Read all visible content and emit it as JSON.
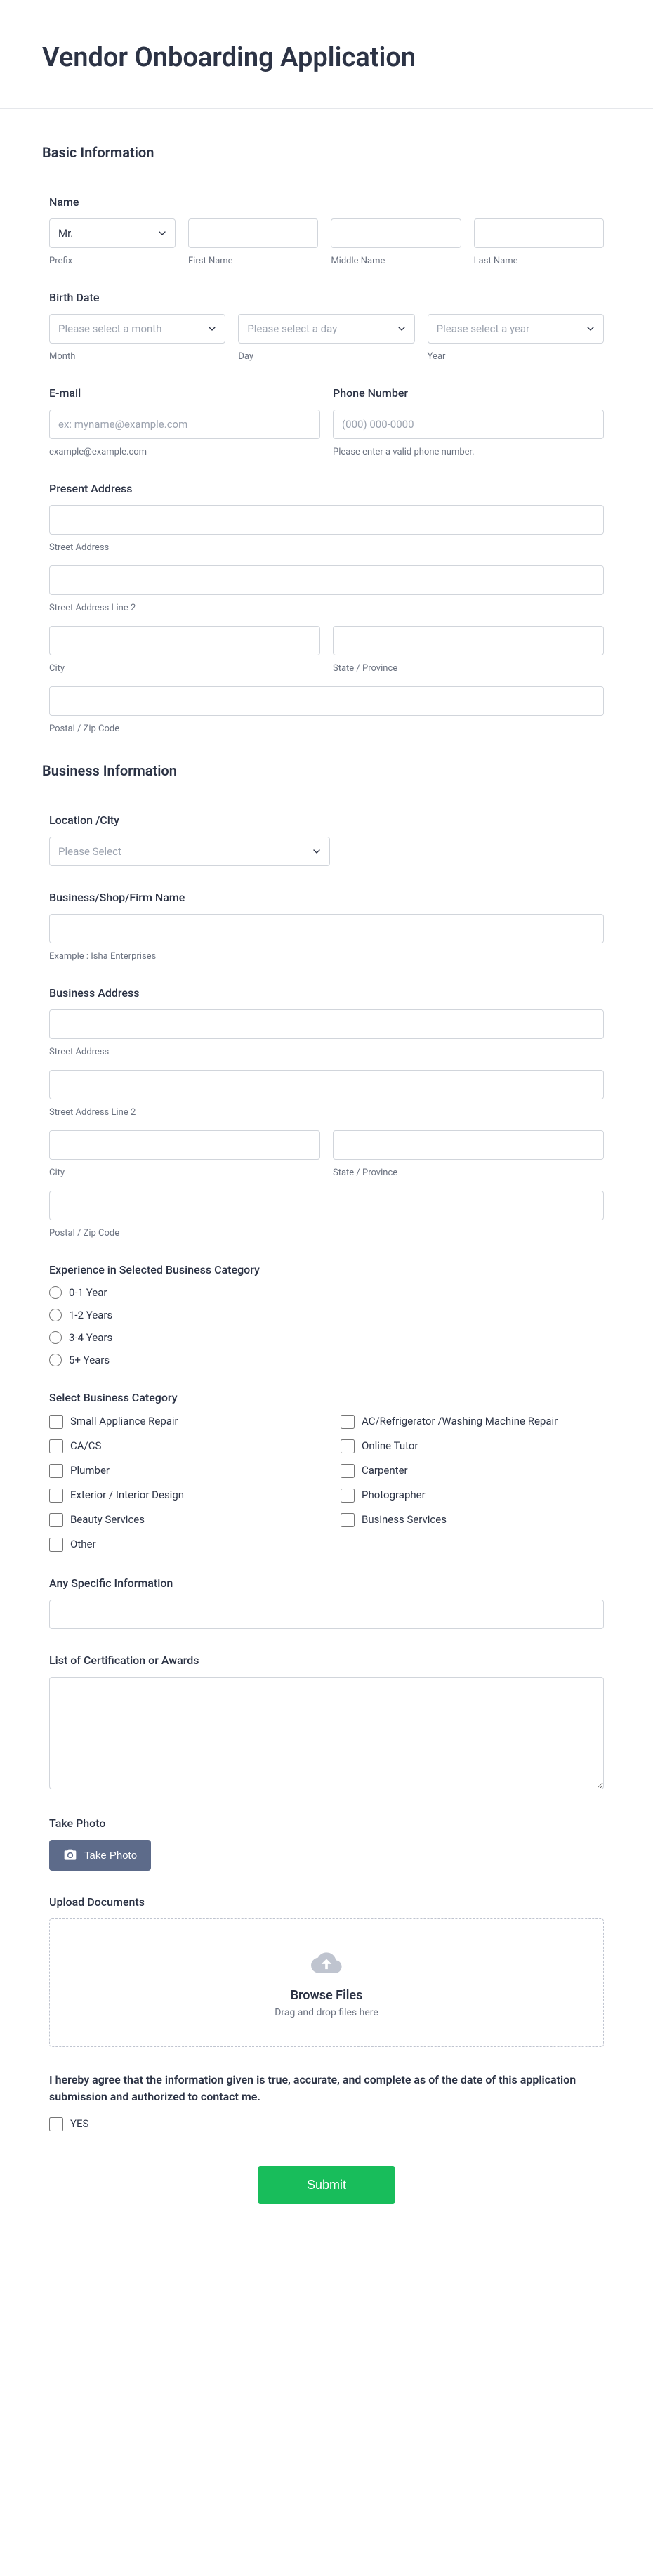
{
  "page_title": "Vendor Onboarding Application",
  "sections": {
    "basic": {
      "title": "Basic Information",
      "name": {
        "label": "Name",
        "prefix_default": "Mr.",
        "prefix_sub": "Prefix",
        "first_sub": "First Name",
        "middle_sub": "Middle Name",
        "last_sub": "Last Name"
      },
      "birth": {
        "label": "Birth Date",
        "month_ph": "Please select a month",
        "month_sub": "Month",
        "day_ph": "Please select a day",
        "day_sub": "Day",
        "year_ph": "Please select a year",
        "year_sub": "Year"
      },
      "email": {
        "label": "E-mail",
        "placeholder": "ex: myname@example.com",
        "sub": "example@example.com"
      },
      "phone": {
        "label": "Phone Number",
        "placeholder": "(000) 000-0000",
        "sub": "Please enter a valid phone number."
      },
      "address": {
        "label": "Present Address",
        "street": "Street Address",
        "street2": "Street Address Line 2",
        "city": "City",
        "state": "State / Province",
        "zip": "Postal / Zip Code"
      }
    },
    "business": {
      "title": "Business Information",
      "location": {
        "label": "Location /City",
        "placeholder": "Please Select"
      },
      "shop": {
        "label": "Business/Shop/Firm Name",
        "sub": "Example : Isha Enterprises"
      },
      "address": {
        "label": "Business Address",
        "street": "Street Address",
        "street2": "Street Address Line 2",
        "city": "City",
        "state": "State / Province",
        "zip": "Postal / Zip Code"
      },
      "experience": {
        "label": "Experience in Selected Business Category",
        "options": [
          "0-1 Year",
          "1-2 Years",
          "3-4 Years",
          "5+ Years"
        ]
      },
      "category": {
        "label": "Select Business Category",
        "left": [
          "Small Appliance Repair",
          "CA/CS",
          "Plumber",
          "Exterior / Interior Design",
          "Beauty Services",
          "Other"
        ],
        "right": [
          "AC/Refrigerator /Washing Machine Repair",
          "Online Tutor",
          "Carpenter",
          "Photographer",
          "Business Services"
        ]
      },
      "specific": {
        "label": "Any Specific Information"
      },
      "cert": {
        "label": "List of Certification or Awards"
      },
      "photo": {
        "label": "Take Photo",
        "button": "Take Photo"
      },
      "upload": {
        "label": "Upload Documents",
        "browse": "Browse Files",
        "sub": "Drag and drop files here"
      },
      "agreement": {
        "text": "I hereby agree that the information given is true, accurate, and complete as of the date of this application submission and authorized to contact me.",
        "yes": "YES"
      }
    }
  },
  "submit": "Submit"
}
